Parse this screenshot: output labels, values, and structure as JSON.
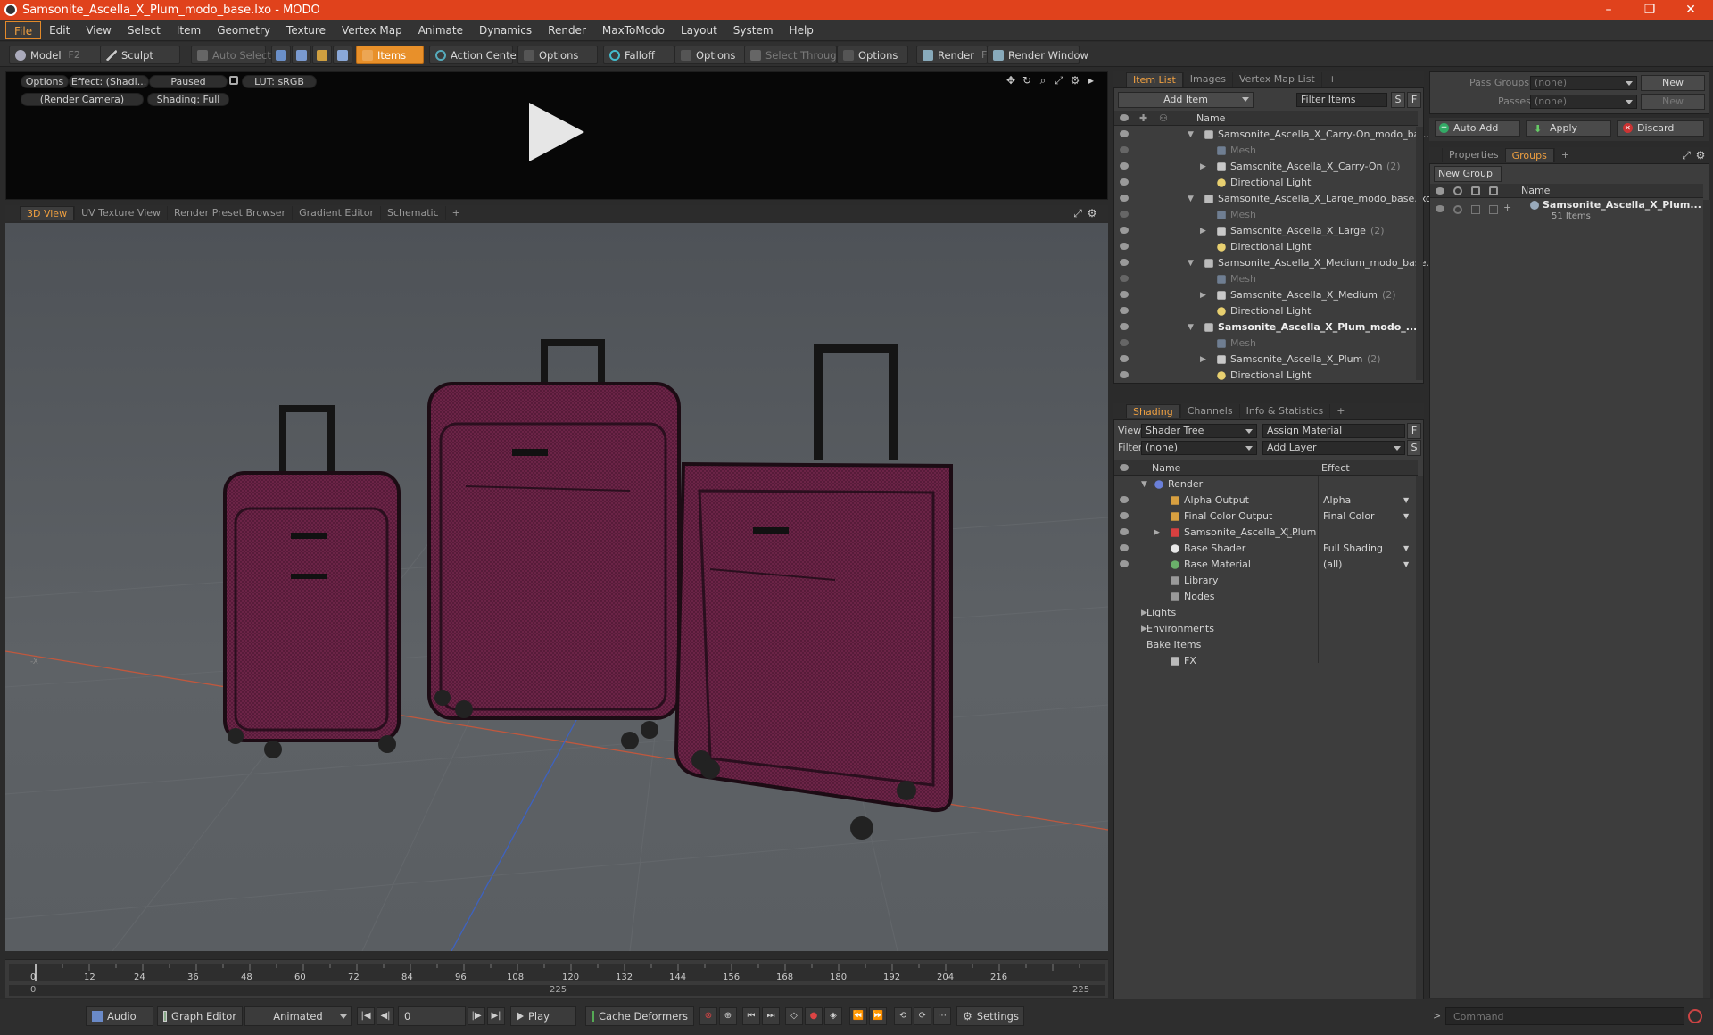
{
  "window": {
    "title": "Samsonite_Ascella_X_Plum_modo_base.lxo - MODO",
    "minimize": "–",
    "maximize": "❐",
    "close": "✕"
  },
  "menu": [
    "File",
    "Edit",
    "View",
    "Select",
    "Item",
    "Geometry",
    "Texture",
    "Vertex Map",
    "Animate",
    "Dynamics",
    "Render",
    "MaxToModo",
    "Layout",
    "System",
    "Help"
  ],
  "toolbar": {
    "model": "Model",
    "model_key": "F2",
    "sculpt": "Sculpt",
    "auto_select": "Auto Select",
    "items": "Items",
    "action_center": "Action Center",
    "options1": "Options",
    "falloff": "Falloff",
    "options2": "Options",
    "select_through": "Select Through",
    "options3": "Options",
    "render": "Render",
    "render_key": "F9",
    "render_window": "Render Window"
  },
  "preview": {
    "options": "Options",
    "effect": "Effect: (Shadi...",
    "paused": "Paused",
    "lut": "LUT: sRGB",
    "camera": "(Render Camera)",
    "shading": "Shading: Full"
  },
  "viewport_tabs": [
    "3D View",
    "UV Texture View",
    "Render Preset Browser",
    "Gradient Editor",
    "Schematic",
    "+"
  ],
  "item_list": {
    "tabs": [
      "Item List",
      "Images",
      "Vertex Map List",
      "+"
    ],
    "add_item": "Add Item",
    "filter_items": "Filter Items",
    "s_btn": "S",
    "f_btn": "F",
    "col_name": "Name",
    "rows": [
      {
        "text": "Samsonite_Ascella_X_Carry-On_modo_ba...",
        "count": "",
        "indent": 1,
        "kind": "scene",
        "dim": false,
        "bold": false
      },
      {
        "text": "Mesh",
        "count": "",
        "indent": 2,
        "kind": "mesh",
        "dim": true,
        "bold": false
      },
      {
        "text": "Samsonite_Ascella_X_Carry-On",
        "count": "(2)",
        "indent": 2,
        "kind": "group",
        "dim": false,
        "bold": false
      },
      {
        "text": "Directional Light",
        "count": "",
        "indent": 2,
        "kind": "light",
        "dim": false,
        "bold": false
      },
      {
        "text": "Samsonite_Ascella_X_Large_modo_base.lxo",
        "count": "",
        "indent": 1,
        "kind": "scene",
        "dim": false,
        "bold": false
      },
      {
        "text": "Mesh",
        "count": "",
        "indent": 2,
        "kind": "mesh",
        "dim": true,
        "bold": false
      },
      {
        "text": "Samsonite_Ascella_X_Large",
        "count": "(2)",
        "indent": 2,
        "kind": "group",
        "dim": false,
        "bold": false
      },
      {
        "text": "Directional Light",
        "count": "",
        "indent": 2,
        "kind": "light",
        "dim": false,
        "bold": false
      },
      {
        "text": "Samsonite_Ascella_X_Medium_modo_base....",
        "count": "",
        "indent": 1,
        "kind": "scene",
        "dim": false,
        "bold": false
      },
      {
        "text": "Mesh",
        "count": "",
        "indent": 2,
        "kind": "mesh",
        "dim": true,
        "bold": false
      },
      {
        "text": "Samsonite_Ascella_X_Medium",
        "count": "(2)",
        "indent": 2,
        "kind": "group",
        "dim": false,
        "bold": false
      },
      {
        "text": "Directional Light",
        "count": "",
        "indent": 2,
        "kind": "light",
        "dim": false,
        "bold": false
      },
      {
        "text": "Samsonite_Ascella_X_Plum_modo_...",
        "count": "",
        "indent": 1,
        "kind": "scene",
        "dim": false,
        "bold": true
      },
      {
        "text": "Mesh",
        "count": "",
        "indent": 2,
        "kind": "mesh",
        "dim": true,
        "bold": false
      },
      {
        "text": "Samsonite_Ascella_X_Plum",
        "count": "(2)",
        "indent": 2,
        "kind": "group",
        "dim": false,
        "bold": false
      },
      {
        "text": "Directional Light",
        "count": "",
        "indent": 2,
        "kind": "light",
        "dim": false,
        "bold": false
      }
    ]
  },
  "shading": {
    "tabs": [
      "Shading",
      "Channels",
      "Info & Statistics",
      "+"
    ],
    "view_label": "View",
    "view_value": "Shader Tree",
    "assign_material": "Assign Material",
    "f_btn": "F",
    "filter_label": "Filter",
    "filter_value": "(none)",
    "add_layer": "Add Layer",
    "s_btn": "S",
    "col_name": "Name",
    "col_effect": "Effect",
    "rows": [
      {
        "name": "Render",
        "effect": "",
        "indent": 0,
        "icon": "render",
        "eye": false
      },
      {
        "name": "Alpha Output",
        "effect": "Alpha",
        "indent": 1,
        "icon": "output",
        "eye": true
      },
      {
        "name": "Final Color Output",
        "effect": "Final Color",
        "indent": 1,
        "icon": "output",
        "eye": true
      },
      {
        "name": "Samsonite_Ascella_X_Plum",
        "effect": "",
        "indent": 1,
        "icon": "material-group",
        "eye": true,
        "suffix": "(..."
      },
      {
        "name": "Base Shader",
        "effect": "Full Shading",
        "indent": 1,
        "icon": "shader",
        "eye": true
      },
      {
        "name": "Base Material",
        "effect": "(all)",
        "indent": 1,
        "icon": "material",
        "eye": true
      },
      {
        "name": "Library",
        "effect": "",
        "indent": 1,
        "icon": "folder",
        "eye": false
      },
      {
        "name": "Nodes",
        "effect": "",
        "indent": 1,
        "icon": "folder",
        "eye": false
      },
      {
        "name": "Lights",
        "effect": "",
        "indent": 0,
        "icon": "none",
        "eye": false
      },
      {
        "name": "Environments",
        "effect": "",
        "indent": 0,
        "icon": "none",
        "eye": false
      },
      {
        "name": "Bake Items",
        "effect": "",
        "indent": 0,
        "icon": "none",
        "eye": false
      },
      {
        "name": "FX",
        "effect": "",
        "indent": 1,
        "icon": "fx",
        "eye": false
      }
    ]
  },
  "pass_groups": {
    "label": "Pass Groups",
    "value": "(none)",
    "new": "New",
    "passes_label": "Passes",
    "passes_value": "(none)",
    "passes_new": "New"
  },
  "actions": {
    "auto_add": "Auto Add",
    "apply": "Apply",
    "discard": "Discard"
  },
  "groups": {
    "tabs": [
      "Properties",
      "Groups",
      "+"
    ],
    "new_group": "New Group",
    "col_name": "Name",
    "item_name": "Samsonite_Ascella_X_Plum...",
    "item_count": "51 Items"
  },
  "timeline": {
    "ticks": [
      "0",
      "12",
      "24",
      "36",
      "48",
      "60",
      "72",
      "84",
      "96",
      "108",
      "120",
      "132",
      "144",
      "156",
      "168",
      "180",
      "192",
      "204",
      "216"
    ],
    "range_start": "0",
    "range_mid": "225",
    "range_end": "225"
  },
  "bottom": {
    "audio": "Audio",
    "graph_editor": "Graph Editor",
    "animated": "Animated",
    "frame": "0",
    "play": "Play",
    "cache_deformers": "Cache Deformers",
    "settings": "Settings",
    "command_placeholder": "Command"
  },
  "colors": {
    "accent": "#e8902a",
    "titlebar": "#e0421c",
    "luggage": "#7a2a52"
  }
}
